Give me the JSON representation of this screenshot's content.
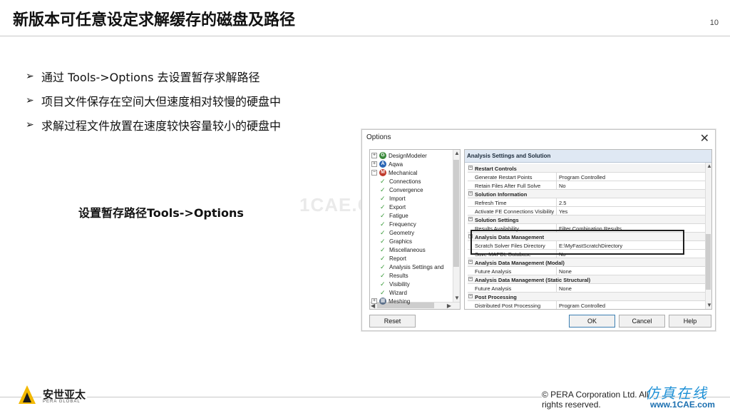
{
  "slide": {
    "title": "新版本可任意设定求解缓存的磁盘及路径",
    "page_number": "10",
    "bullets": [
      "通过 Tools->Options 去设置暂存求解路径",
      "项目文件保存在空间大但速度相对较慢的硬盘中",
      "求解过程文件放置在速度较快容量较小的硬盘中"
    ],
    "bullet_icon": "arrow-bullet-icon",
    "path_note": "设置暂存路径Tools->Options",
    "watermark_mid": "1CAE.COM"
  },
  "dialog": {
    "title": "Options",
    "close_icon": "close-icon",
    "tree": [
      {
        "label": "DesignModeler",
        "expander": "+",
        "icon": "G",
        "color": "#3b8a3b"
      },
      {
        "label": "Aqwa",
        "expander": "+",
        "icon": "A",
        "color": "#2a66b5"
      },
      {
        "label": "Mechanical",
        "expander": "−",
        "icon": "M",
        "color": "#c0392b"
      },
      {
        "label": "Connections"
      },
      {
        "label": "Convergence"
      },
      {
        "label": "Import"
      },
      {
        "label": "Export"
      },
      {
        "label": "Fatigue"
      },
      {
        "label": "Frequency"
      },
      {
        "label": "Geometry"
      },
      {
        "label": "Graphics"
      },
      {
        "label": "Miscellaneous"
      },
      {
        "label": "Report"
      },
      {
        "label": "Analysis Settings and"
      },
      {
        "label": "Results"
      },
      {
        "label": "Visibility"
      },
      {
        "label": "Wizard"
      },
      {
        "label": "Meshing",
        "expander": "+",
        "icon": "▦",
        "color": "#5a6f8a"
      }
    ],
    "panel_header": "Analysis Settings and Solution",
    "rows": [
      {
        "type": "section",
        "label": "Restart Controls"
      },
      {
        "type": "prop",
        "label": "Generate Restart Points",
        "value": "Program Controlled"
      },
      {
        "type": "prop",
        "label": "Retain Files After Full Solve",
        "value": "No"
      },
      {
        "type": "section",
        "label": "Solution Information"
      },
      {
        "type": "prop",
        "label": "Refresh Time",
        "value": "2.5"
      },
      {
        "type": "prop",
        "label": "Activate FE Connections Visibility",
        "value": "Yes"
      },
      {
        "type": "section",
        "label": "Solution Settings"
      },
      {
        "type": "prop",
        "label": "Results Availability",
        "value": "Filter Combination Results"
      },
      {
        "type": "section",
        "label": "Analysis Data Management"
      },
      {
        "type": "prop",
        "label": "Scratch Solver Files Directory",
        "value": "E:\\MyFastScratchDirectory"
      },
      {
        "type": "prop",
        "label": "Save MAPDL Database",
        "value": "No"
      },
      {
        "type": "section",
        "label": "Analysis Data Management (Modal)"
      },
      {
        "type": "prop",
        "label": "Future Analysis",
        "value": "None"
      },
      {
        "type": "section",
        "label": "Analysis Data Management (Static Structural)"
      },
      {
        "type": "prop",
        "label": "Future Analysis",
        "value": "None"
      },
      {
        "type": "section",
        "label": "Post Processing"
      },
      {
        "type": "prop",
        "label": "Distributed Post Processing",
        "value": "Program Controlled"
      }
    ],
    "buttons": {
      "reset": "Reset",
      "ok": "OK",
      "cancel": "Cancel",
      "help": "Help"
    }
  },
  "footer": {
    "logo_cn": "安世亚太",
    "logo_en": "PERA GLOBAL",
    "copyright": "©  PERA Corporation Ltd. All rights reserved.",
    "watermark_cn": "仿真在线",
    "watermark_url": "www.1CAE.com"
  },
  "colors": {
    "logo_yellow": "#f2b800",
    "watermark_blue": "#1b8fd6",
    "highlight": "#1e1e1e"
  }
}
